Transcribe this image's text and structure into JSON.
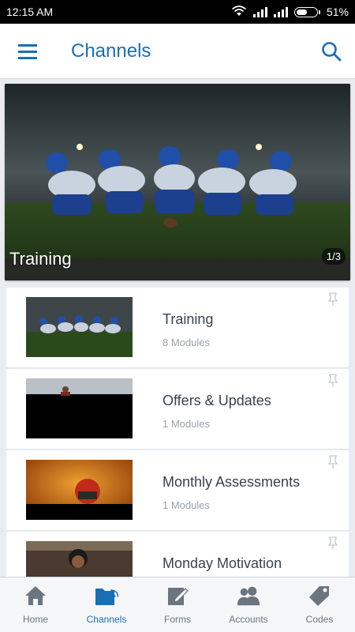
{
  "status_bar": {
    "time": "12:15 AM",
    "battery": "51%",
    "battery_level": 0.51
  },
  "app_bar": {
    "title": "Channels",
    "menu_icon": "hamburger-menu-icon",
    "search_icon": "search-icon"
  },
  "hero": {
    "title": "Training",
    "page_indicator": "1/3"
  },
  "channels": [
    {
      "title": "Training",
      "subtitle": "8 Modules"
    },
    {
      "title": "Offers & Updates",
      "subtitle": "1 Modules"
    },
    {
      "title": "Monthly Assessments",
      "subtitle": "1 Modules"
    },
    {
      "title": "Monday Motivation",
      "subtitle": ""
    }
  ],
  "bottom_nav": [
    {
      "label": "Home",
      "icon": "home-icon"
    },
    {
      "label": "Channels",
      "icon": "folder-icon"
    },
    {
      "label": "Forms",
      "icon": "edit-icon"
    },
    {
      "label": "Accounts",
      "icon": "people-icon"
    },
    {
      "label": "Codes",
      "icon": "tag-icon"
    }
  ],
  "colors": {
    "accent": "#1a6fb4",
    "nav_inactive": "#6b7580"
  }
}
